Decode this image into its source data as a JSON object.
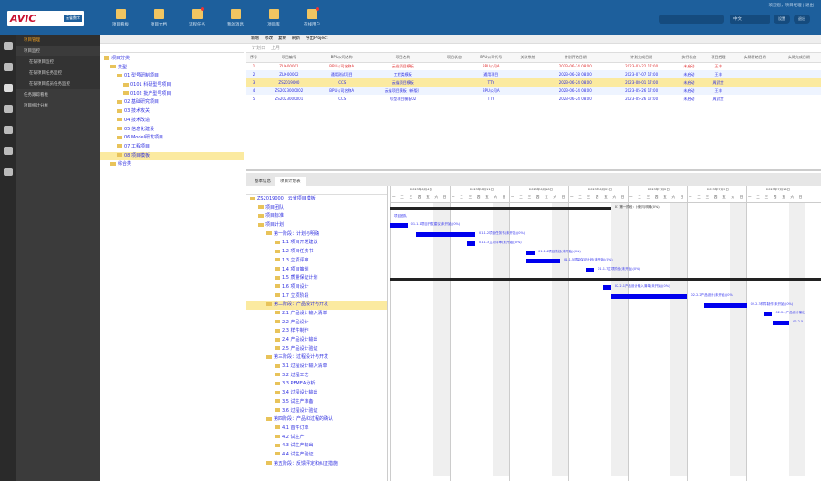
{
  "header": {
    "logo_mark": "AVIC",
    "logo_name": "云雀数字",
    "user": "欢迎您，项目经理 | 退出",
    "search_placeholder": "",
    "select": "中文",
    "btn1": "设置",
    "btn2": "退出",
    "toolbar": [
      {
        "label": "项目看板",
        "alert": false
      },
      {
        "label": "项目文档",
        "alert": false
      },
      {
        "label": "流程任务",
        "alert": true
      },
      {
        "label": "我的消息",
        "alert": false
      },
      {
        "label": "项目库",
        "alert": false
      },
      {
        "label": "在线用户",
        "alert": true
      }
    ]
  },
  "sidebar": {
    "title": "项目管理",
    "items": [
      {
        "label": "项目监控",
        "sub": [
          "在研项目监控",
          "在研项目任务监控",
          "在研项目成员任务监控"
        ]
      },
      {
        "label": "任务跟踪看板"
      },
      {
        "label": "项目统计分析"
      }
    ]
  },
  "tree": {
    "toolbar": [
      "新增",
      "修改",
      "复制",
      "刷新",
      "导出Project"
    ],
    "items": [
      {
        "label": "项目分类",
        "lvl": 0
      },
      {
        "label": "类型",
        "lvl": 1
      },
      {
        "label": "01 型号研制项目",
        "lvl": 2
      },
      {
        "label": "0101 科研型号项目",
        "lvl": 3
      },
      {
        "label": "0102 批产型号项目",
        "lvl": 3
      },
      {
        "label": "02 基础研究项目",
        "lvl": 2
      },
      {
        "label": "03 技术攻关",
        "lvl": 2
      },
      {
        "label": "04 技术改造",
        "lvl": 2
      },
      {
        "label": "05 信息化建设",
        "lvl": 2
      },
      {
        "label": "06 Model研发项目",
        "lvl": 2
      },
      {
        "label": "07 工程项目",
        "lvl": 2
      },
      {
        "label": "08 项目模板",
        "lvl": 2,
        "hl": true
      },
      {
        "label": "综合类",
        "lvl": 1
      }
    ]
  },
  "grid": {
    "filters": [
      "计划日",
      "上月"
    ],
    "columns": [
      "序号",
      "项目编号",
      "BPU公司名称",
      "项目名称",
      "项目状态",
      "BPU公司代号",
      "关联系统",
      "计划开始日期",
      "计划完成日期",
      "执行状态",
      "项目经理",
      "实际开始日期",
      "实际完成日期"
    ],
    "rows": [
      {
        "c": [
          "1",
          "ZLK-00001",
          "BPU公司名称A",
          "云雀项目模板",
          "",
          "BPU公司A",
          "",
          "2023-06-24 08:00",
          "2023-03-22 17:00",
          "未启动",
          "王丰",
          "",
          ""
        ],
        "color": "#e03030"
      },
      {
        "c": [
          "2",
          "ZLK-00002",
          "通用测试项目",
          "工程类模板",
          "",
          "通用项目",
          "",
          "2023-06-28 08:00",
          "2023-07-07 17:00",
          "未启动",
          "王丰",
          "",
          ""
        ],
        "color": "#2d2de0"
      },
      {
        "c": [
          "3",
          "ZS2019000",
          "ICCS",
          "云雀项目模板",
          "",
          "TTY",
          "",
          "2023-06-24 08:00",
          "2023-08-01 17:00",
          "未启动",
          "周武堂",
          "",
          ""
        ],
        "color": "#2d2de0",
        "hl": true
      },
      {
        "c": [
          "4",
          "ZS2023000002",
          "BPU公司名称A",
          "云雀项目模板（新版）",
          "",
          "BPU公司A",
          "",
          "2023-06-24 08:00",
          "2023-05-26 17:00",
          "未启动",
          "王丰",
          "",
          ""
        ],
        "color": "#2d2de0"
      },
      {
        "c": [
          "5",
          "ZS2023000001",
          "ICCS",
          "号型项目模板02",
          "",
          "TTY",
          "",
          "2023-06-24 08:00",
          "2023-05-26 17:00",
          "未启动",
          "周武堂",
          "",
          ""
        ],
        "color": "#2d2de0"
      }
    ]
  },
  "bottom": {
    "tabs": [
      "基本信息",
      "项目计划表"
    ],
    "active": 1
  },
  "gantt": {
    "weeks": [
      "2023年6月4日",
      "2023年6月11日",
      "2023年6月18日",
      "2023年6月25日",
      "2023年7月2日",
      "2023年7月9日",
      "2023年7月16日"
    ],
    "days": [
      "一",
      "二",
      "三",
      "四",
      "五",
      "六",
      "日"
    ],
    "tree": [
      {
        "label": "ZS2019000 | 云雀项目模板",
        "lvl": 0
      },
      {
        "label": "项目团队",
        "lvl": 1
      },
      {
        "label": "项目标准",
        "lvl": 1
      },
      {
        "label": "项目计划",
        "lvl": 1
      },
      {
        "label": "第一阶段：计划与明确",
        "lvl": 2
      },
      {
        "label": "1.1 项目开发建议",
        "lvl": 3
      },
      {
        "label": "1.2 项目任务书",
        "lvl": 3
      },
      {
        "label": "1.3 立项评审",
        "lvl": 3
      },
      {
        "label": "1.4 项目策划",
        "lvl": 3
      },
      {
        "label": "1.5 质量保证计划",
        "lvl": 3
      },
      {
        "label": "1.6 项目设计",
        "lvl": 3
      },
      {
        "label": "1.7 立项阶段",
        "lvl": 3
      },
      {
        "label": "第二阶段：产品设计与开发",
        "lvl": 2,
        "hl": true
      },
      {
        "label": "2.1 产品设计输入清单",
        "lvl": 3
      },
      {
        "label": "2.2 产品设计",
        "lvl": 3
      },
      {
        "label": "2.3 样件制作",
        "lvl": 3
      },
      {
        "label": "2.4 产品设计输出",
        "lvl": 3
      },
      {
        "label": "2.5 产品设计验证",
        "lvl": 3
      },
      {
        "label": "第三阶段：过程设计与开发",
        "lvl": 2
      },
      {
        "label": "3.1 过程设计输入清单",
        "lvl": 3
      },
      {
        "label": "3.2 过程工艺",
        "lvl": 3
      },
      {
        "label": "3.3 PFMEA分析",
        "lvl": 3
      },
      {
        "label": "3.4 过程设计输出",
        "lvl": 3
      },
      {
        "label": "3.5 试生产准备",
        "lvl": 3
      },
      {
        "label": "3.6 过程设计验证",
        "lvl": 3
      },
      {
        "label": "第四阶段：产品和过程的确认",
        "lvl": 2
      },
      {
        "label": "4.1 首件订单",
        "lvl": 3
      },
      {
        "label": "4.2 试生产",
        "lvl": 3
      },
      {
        "label": "4.3 试生产输出",
        "lvl": 3
      },
      {
        "label": "4.4 试生产验证",
        "lvl": 3
      },
      {
        "label": "第五阶段：反馈评定和纠正措施",
        "lvl": 2
      }
    ],
    "bars": [
      {
        "row": 0,
        "start": 0,
        "dur": 26,
        "sum": true,
        "label": "01 第一阶段：计划与明确(0%)"
      },
      {
        "row": 1,
        "start": 0,
        "dur": 0,
        "label": "项目团队"
      },
      {
        "row": 2,
        "start": 0,
        "dur": 2,
        "label": "01.1.1项目开发建议(未开始)(0%)"
      },
      {
        "row": 3,
        "start": 3,
        "dur": 7,
        "label": "01.1.2项目任务书(未开始)(0%)"
      },
      {
        "row": 4,
        "start": 9,
        "dur": 1,
        "label": "01.1.3立项评审(未开始)(0%)"
      },
      {
        "row": 5,
        "start": 16,
        "dur": 1,
        "label": "01.1.4项目策划(未开始)(0%)"
      },
      {
        "row": 6,
        "start": 16,
        "dur": 4,
        "label": "01.1.5质量保证计划(未开始)(0%)"
      },
      {
        "row": 7,
        "start": 23,
        "dur": 1,
        "label": "01.1.7立项阶段(未开始)(0%)"
      },
      {
        "row": 8,
        "start": 0,
        "dur": 60,
        "sum": true,
        "label": ""
      },
      {
        "row": 9,
        "start": 25,
        "dur": 1,
        "label": "02.2.1产品设计输入清单(未开始)(0%)"
      },
      {
        "row": 10,
        "start": 26,
        "dur": 9,
        "label": "02.2.2产品设计(未开始)(0%)"
      },
      {
        "row": 11,
        "start": 37,
        "dur": 5,
        "label": "02.2.3样件制作(未开始)(0%)"
      },
      {
        "row": 12,
        "start": 44,
        "dur": 1,
        "label": "02.2.4产品设计输出"
      },
      {
        "row": 13,
        "start": 45,
        "dur": 2,
        "label": "02.2.5"
      }
    ]
  },
  "colors": {
    "topbar": "#1d5f9c",
    "bar": "#0000ee",
    "highlight": "#fbeaa0"
  }
}
